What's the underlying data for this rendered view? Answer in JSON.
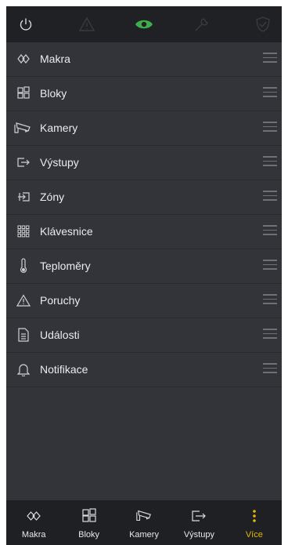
{
  "topbar": {
    "icons": [
      "power-icon",
      "warning-icon",
      "eye-icon",
      "wrench-icon",
      "shield-icon"
    ],
    "active_color": "#3fae4a",
    "inactive_color": "#3a3b3f"
  },
  "menu": {
    "items": [
      {
        "icon": "macro-icon",
        "label": "Makra"
      },
      {
        "icon": "blocks-icon",
        "label": "Bloky"
      },
      {
        "icon": "camera-icon",
        "label": "Kamery"
      },
      {
        "icon": "output-icon",
        "label": "Výstupy"
      },
      {
        "icon": "zone-icon",
        "label": "Zóny"
      },
      {
        "icon": "keypad-icon",
        "label": "Klávesnice"
      },
      {
        "icon": "thermometer-icon",
        "label": "Teploměry"
      },
      {
        "icon": "warning-icon",
        "label": "Poruchy"
      },
      {
        "icon": "document-icon",
        "label": "Události"
      },
      {
        "icon": "bell-icon",
        "label": "Notifikace"
      }
    ]
  },
  "bottom_nav": {
    "tabs": [
      {
        "icon": "macro-icon",
        "label": "Makra"
      },
      {
        "icon": "blocks-icon",
        "label": "Bloky"
      },
      {
        "icon": "camera-icon",
        "label": "Kamery"
      },
      {
        "icon": "output-icon",
        "label": "Výstupy"
      },
      {
        "icon": "more-vertical-icon",
        "label": "Více"
      }
    ],
    "active_tab": "Více",
    "active_color": "#e6b800"
  }
}
